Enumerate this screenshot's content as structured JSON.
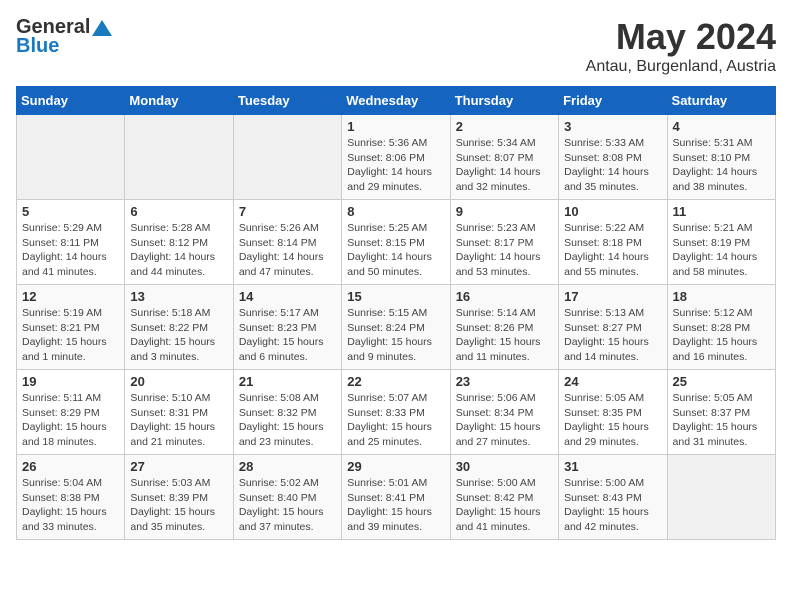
{
  "header": {
    "logo_general": "General",
    "logo_blue": "Blue",
    "month": "May 2024",
    "location": "Antau, Burgenland, Austria"
  },
  "weekdays": [
    "Sunday",
    "Monday",
    "Tuesday",
    "Wednesday",
    "Thursday",
    "Friday",
    "Saturday"
  ],
  "weeks": [
    [
      {
        "day": "",
        "sunrise": "",
        "sunset": "",
        "daylight": ""
      },
      {
        "day": "",
        "sunrise": "",
        "sunset": "",
        "daylight": ""
      },
      {
        "day": "",
        "sunrise": "",
        "sunset": "",
        "daylight": ""
      },
      {
        "day": "1",
        "sunrise": "Sunrise: 5:36 AM",
        "sunset": "Sunset: 8:06 PM",
        "daylight": "Daylight: 14 hours and 29 minutes."
      },
      {
        "day": "2",
        "sunrise": "Sunrise: 5:34 AM",
        "sunset": "Sunset: 8:07 PM",
        "daylight": "Daylight: 14 hours and 32 minutes."
      },
      {
        "day": "3",
        "sunrise": "Sunrise: 5:33 AM",
        "sunset": "Sunset: 8:08 PM",
        "daylight": "Daylight: 14 hours and 35 minutes."
      },
      {
        "day": "4",
        "sunrise": "Sunrise: 5:31 AM",
        "sunset": "Sunset: 8:10 PM",
        "daylight": "Daylight: 14 hours and 38 minutes."
      }
    ],
    [
      {
        "day": "5",
        "sunrise": "Sunrise: 5:29 AM",
        "sunset": "Sunset: 8:11 PM",
        "daylight": "Daylight: 14 hours and 41 minutes."
      },
      {
        "day": "6",
        "sunrise": "Sunrise: 5:28 AM",
        "sunset": "Sunset: 8:12 PM",
        "daylight": "Daylight: 14 hours and 44 minutes."
      },
      {
        "day": "7",
        "sunrise": "Sunrise: 5:26 AM",
        "sunset": "Sunset: 8:14 PM",
        "daylight": "Daylight: 14 hours and 47 minutes."
      },
      {
        "day": "8",
        "sunrise": "Sunrise: 5:25 AM",
        "sunset": "Sunset: 8:15 PM",
        "daylight": "Daylight: 14 hours and 50 minutes."
      },
      {
        "day": "9",
        "sunrise": "Sunrise: 5:23 AM",
        "sunset": "Sunset: 8:17 PM",
        "daylight": "Daylight: 14 hours and 53 minutes."
      },
      {
        "day": "10",
        "sunrise": "Sunrise: 5:22 AM",
        "sunset": "Sunset: 8:18 PM",
        "daylight": "Daylight: 14 hours and 55 minutes."
      },
      {
        "day": "11",
        "sunrise": "Sunrise: 5:21 AM",
        "sunset": "Sunset: 8:19 PM",
        "daylight": "Daylight: 14 hours and 58 minutes."
      }
    ],
    [
      {
        "day": "12",
        "sunrise": "Sunrise: 5:19 AM",
        "sunset": "Sunset: 8:21 PM",
        "daylight": "Daylight: 15 hours and 1 minute."
      },
      {
        "day": "13",
        "sunrise": "Sunrise: 5:18 AM",
        "sunset": "Sunset: 8:22 PM",
        "daylight": "Daylight: 15 hours and 3 minutes."
      },
      {
        "day": "14",
        "sunrise": "Sunrise: 5:17 AM",
        "sunset": "Sunset: 8:23 PM",
        "daylight": "Daylight: 15 hours and 6 minutes."
      },
      {
        "day": "15",
        "sunrise": "Sunrise: 5:15 AM",
        "sunset": "Sunset: 8:24 PM",
        "daylight": "Daylight: 15 hours and 9 minutes."
      },
      {
        "day": "16",
        "sunrise": "Sunrise: 5:14 AM",
        "sunset": "Sunset: 8:26 PM",
        "daylight": "Daylight: 15 hours and 11 minutes."
      },
      {
        "day": "17",
        "sunrise": "Sunrise: 5:13 AM",
        "sunset": "Sunset: 8:27 PM",
        "daylight": "Daylight: 15 hours and 14 minutes."
      },
      {
        "day": "18",
        "sunrise": "Sunrise: 5:12 AM",
        "sunset": "Sunset: 8:28 PM",
        "daylight": "Daylight: 15 hours and 16 minutes."
      }
    ],
    [
      {
        "day": "19",
        "sunrise": "Sunrise: 5:11 AM",
        "sunset": "Sunset: 8:29 PM",
        "daylight": "Daylight: 15 hours and 18 minutes."
      },
      {
        "day": "20",
        "sunrise": "Sunrise: 5:10 AM",
        "sunset": "Sunset: 8:31 PM",
        "daylight": "Daylight: 15 hours and 21 minutes."
      },
      {
        "day": "21",
        "sunrise": "Sunrise: 5:08 AM",
        "sunset": "Sunset: 8:32 PM",
        "daylight": "Daylight: 15 hours and 23 minutes."
      },
      {
        "day": "22",
        "sunrise": "Sunrise: 5:07 AM",
        "sunset": "Sunset: 8:33 PM",
        "daylight": "Daylight: 15 hours and 25 minutes."
      },
      {
        "day": "23",
        "sunrise": "Sunrise: 5:06 AM",
        "sunset": "Sunset: 8:34 PM",
        "daylight": "Daylight: 15 hours and 27 minutes."
      },
      {
        "day": "24",
        "sunrise": "Sunrise: 5:05 AM",
        "sunset": "Sunset: 8:35 PM",
        "daylight": "Daylight: 15 hours and 29 minutes."
      },
      {
        "day": "25",
        "sunrise": "Sunrise: 5:05 AM",
        "sunset": "Sunset: 8:37 PM",
        "daylight": "Daylight: 15 hours and 31 minutes."
      }
    ],
    [
      {
        "day": "26",
        "sunrise": "Sunrise: 5:04 AM",
        "sunset": "Sunset: 8:38 PM",
        "daylight": "Daylight: 15 hours and 33 minutes."
      },
      {
        "day": "27",
        "sunrise": "Sunrise: 5:03 AM",
        "sunset": "Sunset: 8:39 PM",
        "daylight": "Daylight: 15 hours and 35 minutes."
      },
      {
        "day": "28",
        "sunrise": "Sunrise: 5:02 AM",
        "sunset": "Sunset: 8:40 PM",
        "daylight": "Daylight: 15 hours and 37 minutes."
      },
      {
        "day": "29",
        "sunrise": "Sunrise: 5:01 AM",
        "sunset": "Sunset: 8:41 PM",
        "daylight": "Daylight: 15 hours and 39 minutes."
      },
      {
        "day": "30",
        "sunrise": "Sunrise: 5:00 AM",
        "sunset": "Sunset: 8:42 PM",
        "daylight": "Daylight: 15 hours and 41 minutes."
      },
      {
        "day": "31",
        "sunrise": "Sunrise: 5:00 AM",
        "sunset": "Sunset: 8:43 PM",
        "daylight": "Daylight: 15 hours and 42 minutes."
      },
      {
        "day": "",
        "sunrise": "",
        "sunset": "",
        "daylight": ""
      }
    ]
  ]
}
